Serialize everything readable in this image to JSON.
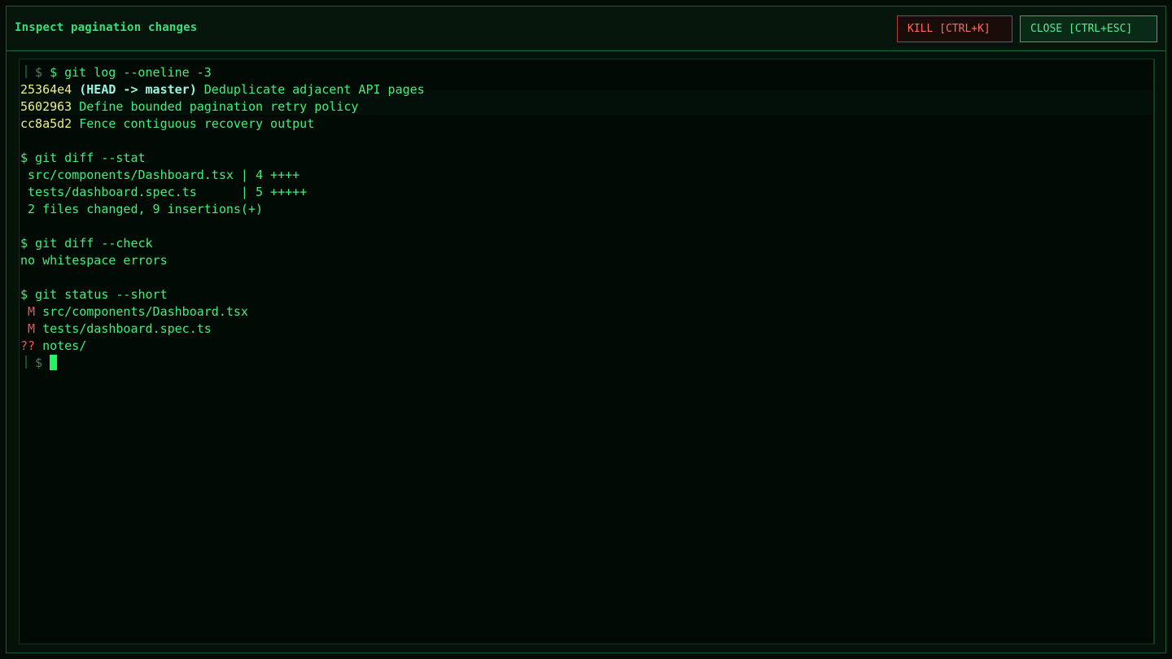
{
  "header": {
    "title": "Inspect pagination changes",
    "kill_label": "KILL [CTRL+K]",
    "close_label": "CLOSE [CTRL+ESC]"
  },
  "terminal": {
    "prompt": "$",
    "log_cmd": "$ git log --oneline -3",
    "commits": [
      {
        "hash": "25364e4",
        "ref_open": "(",
        "ref": "HEAD -> master",
        "ref_close": ")",
        "message": "Deduplicate adjacent API pages"
      },
      {
        "hash": "5602963",
        "message": "Define bounded pagination retry policy"
      },
      {
        "hash": "cc8a5d2",
        "message": "Fence contiguous recovery output"
      }
    ],
    "stat_cmd": "$ git diff --stat",
    "stat_lines": [
      " src/components/Dashboard.tsx | 4 ++++",
      " tests/dashboard.spec.ts      | 5 +++++",
      " 2 files changed, 9 insertions(+)"
    ],
    "check_cmd": "$ git diff --check",
    "check_output": "no whitespace errors",
    "status_cmd": "$ git status --short",
    "status_lines": [
      {
        "code": " M",
        "path": " src/components/Dashboard.tsx"
      },
      {
        "code": " M",
        "path": " tests/dashboard.spec.ts"
      },
      {
        "code": "??",
        "path": " notes/"
      }
    ]
  },
  "colors": {
    "accent": "#3ef07a",
    "hash": "#f0f080",
    "ref": "#9af5e4",
    "modified": "#ff4f4f",
    "kill": "#ff6b5c"
  }
}
